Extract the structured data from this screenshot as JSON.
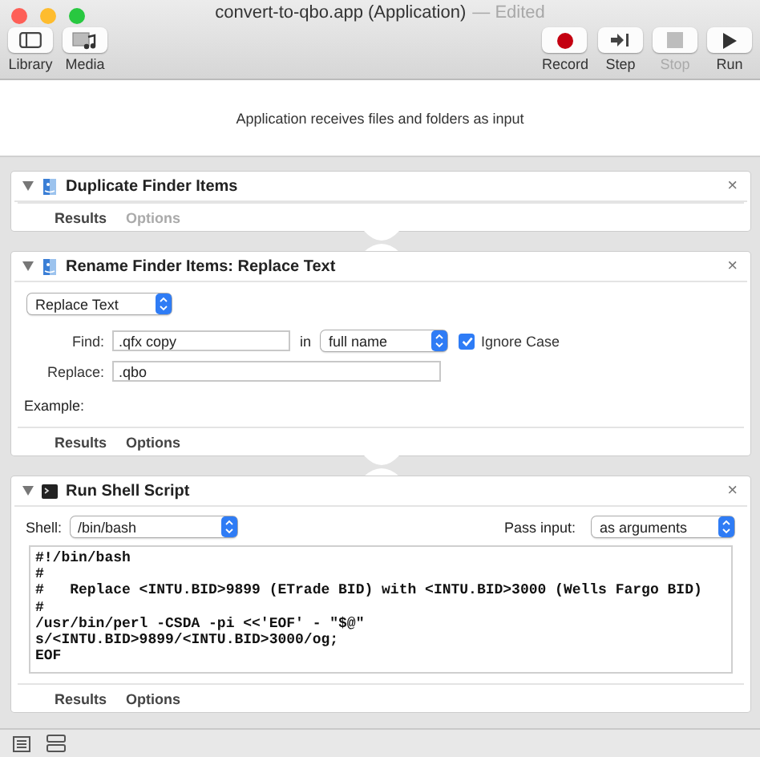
{
  "window": {
    "title": "convert-to-qbo.app (Application)",
    "status": "— Edited"
  },
  "toolbar": {
    "left": [
      {
        "label": "Library",
        "kind": "library"
      },
      {
        "label": "Media",
        "kind": "media"
      }
    ],
    "right": [
      {
        "label": "Record",
        "kind": "record",
        "disabled": false
      },
      {
        "label": "Step",
        "kind": "step",
        "disabled": false
      },
      {
        "label": "Stop",
        "kind": "stop",
        "disabled": true
      },
      {
        "label": "Run",
        "kind": "run",
        "disabled": false
      }
    ]
  },
  "input_banner": "Application receives files and folders as input",
  "actions": [
    {
      "kind": "duplicate",
      "title": "Duplicate Finder Items",
      "expanded": true,
      "close": "×",
      "tabs": [
        {
          "label": "Results",
          "disabled": false
        },
        {
          "label": "Options",
          "disabled": true
        }
      ]
    },
    {
      "kind": "rename",
      "title": "Rename Finder Items: Replace Text",
      "expanded": true,
      "close": "×",
      "mode": "Replace Text",
      "find_label": "Find:",
      "find": ".qfx copy",
      "in_label": "in",
      "in_value": "full name",
      "ignore_case": {
        "label": "Ignore Case",
        "checked": true
      },
      "replace_label": "Replace:",
      "replace": ".qbo",
      "example_label": "Example:",
      "tabs": [
        {
          "label": "Results",
          "disabled": false
        },
        {
          "label": "Options",
          "disabled": false
        }
      ]
    },
    {
      "kind": "shell",
      "title": "Run Shell Script",
      "expanded": true,
      "close": "×",
      "shell_label": "Shell:",
      "shell": "/bin/bash",
      "pass_label": "Pass input:",
      "pass": "as arguments",
      "script": [
        "#!/bin/bash",
        "#",
        "#   Replace <INTU.BID>9899 (ETrade BID) with <INTU.BID>3000 (Wells Fargo BID)",
        "#",
        "/usr/bin/perl -CSDA -pi <<'EOF' - \"$@\"",
        "s/<INTU.BID>9899/<INTU.BID>3000/og;",
        "EOF"
      ],
      "tabs": [
        {
          "label": "Results",
          "disabled": false
        },
        {
          "label": "Options",
          "disabled": false
        }
      ]
    }
  ]
}
